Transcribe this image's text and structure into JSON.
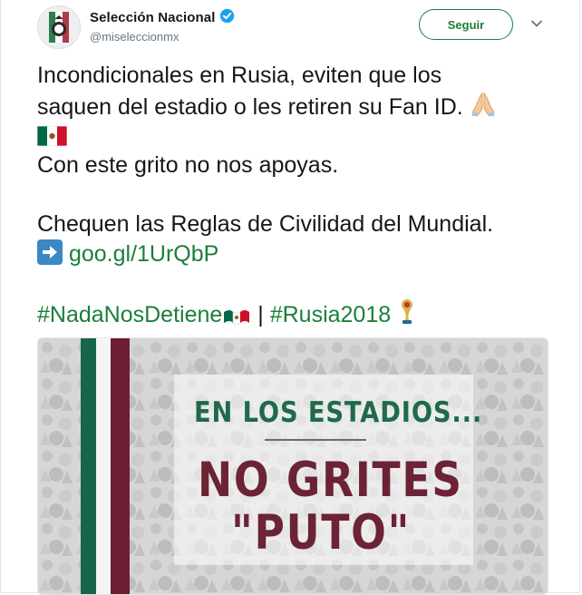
{
  "author": {
    "name": "Selección Nacional",
    "handle": "@miseleccionmx",
    "avatar_icon": "mexico-crest-icon",
    "verified_icon": "verified-badge-icon"
  },
  "actions": {
    "follow_label": "Seguir",
    "menu_icon": "chevron-down-icon"
  },
  "tweet": {
    "line1": "Incondicionales en Rusia, eviten que los",
    "line2": "saquen del estadio o les retiren su Fan ID.",
    "line3": "Con este grito no nos apoyas.",
    "line4": "Chequen las Reglas de Civilidad del Mundial.",
    "link": "goo.gl/1UrQbP",
    "hashtag1": "#NadaNosDetiene",
    "separator": "|",
    "hashtag2": "#Rusia2018"
  },
  "media": {
    "headline": "EN LOS ESTADIOS...",
    "main_line1": "NO GRITES",
    "main_line2": "\"PUTO\""
  },
  "colors": {
    "brand_green": "#1a7f3b",
    "verified_blue": "#1da1f2",
    "flag_green": "#19654a",
    "flag_red": "#6e1f34",
    "text": "#14171a",
    "muted": "#657786"
  }
}
